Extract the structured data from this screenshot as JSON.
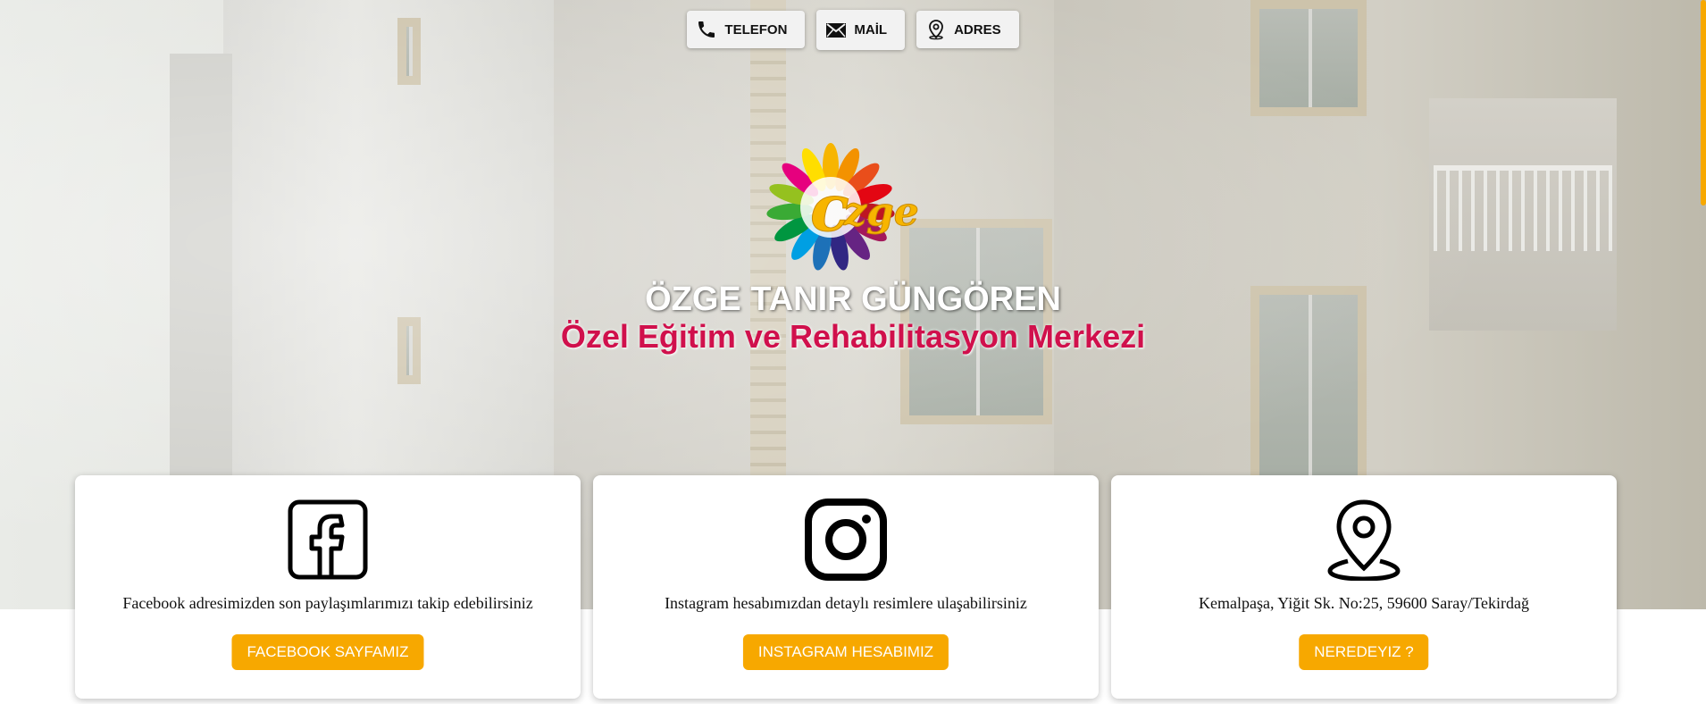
{
  "top_buttons": [
    {
      "label": "TELEFON",
      "icon": "phone-icon"
    },
    {
      "label": "MAİL",
      "icon": "mail-icon"
    },
    {
      "label": "ADRES",
      "icon": "location-pin-icon"
    }
  ],
  "hero": {
    "logo_alt": "ozge-logo",
    "title": "ÖZGE TANIR GÜNGÖREN",
    "subtitle": "Özel Eğitim ve Rehabilitasyon Merkezi"
  },
  "cards": [
    {
      "icon": "facebook-icon",
      "text": "Facebook adresimizden son paylaşımlarımızı takip edebilirsiniz",
      "button": "FACEBOOK SAYFAMIZ"
    },
    {
      "icon": "instagram-icon",
      "text": "Instagram hesabımızdan detaylı resimlere ulaşabilirsiniz",
      "button": "INSTAGRAM HESABIMIZ"
    },
    {
      "icon": "map-pin-icon",
      "text": "Kemalpaşa, Yiğit Sk. No:25, 59600 Saray/Tekirdağ",
      "button": "NEREDEYIZ ?"
    }
  ],
  "colors": {
    "accent": "#f7a800",
    "subtitle": "#d0104c",
    "title": "#ffffff"
  }
}
